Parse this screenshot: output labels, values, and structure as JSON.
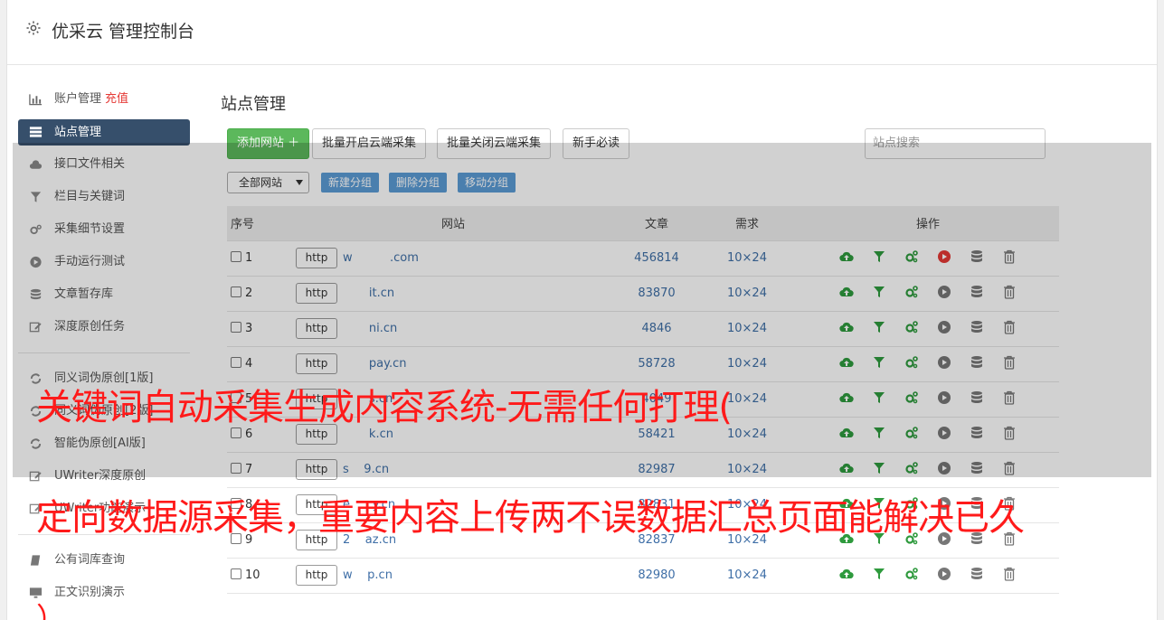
{
  "header": {
    "title": "优采云 管理控制台"
  },
  "sidebar": {
    "items": [
      {
        "label": "账户管理",
        "badge": "充值",
        "icon": "bar-chart-icon"
      },
      {
        "label": "站点管理",
        "icon": "server-icon",
        "active": true
      },
      {
        "label": "接口文件相关",
        "icon": "cloud-upload-icon"
      },
      {
        "label": "栏目与关键词",
        "icon": "filter-icon"
      },
      {
        "label": "采集细节设置",
        "icon": "cogs-icon"
      },
      {
        "label": "手动运行测试",
        "icon": "play-circle-icon"
      },
      {
        "label": "文章暂存库",
        "icon": "database-icon"
      },
      {
        "label": "深度原创任务",
        "icon": "edit-icon"
      }
    ],
    "items2": [
      {
        "label": "同义词伪原创[1版]",
        "icon": "refresh-icon"
      },
      {
        "label": "同义词伪原创[2版]",
        "icon": "refresh-icon"
      },
      {
        "label": "智能伪原创[AI版]",
        "icon": "refresh-icon"
      },
      {
        "label": "UWriter深度原创",
        "icon": "edit-icon"
      },
      {
        "label": "UWriter功能演示",
        "icon": "edit-icon"
      }
    ],
    "items3": [
      {
        "label": "公有词库查询",
        "icon": "book-icon"
      },
      {
        "label": "正文识别演示",
        "icon": "monitor-icon"
      }
    ]
  },
  "main": {
    "title": "站点管理",
    "toolbar": {
      "add": "添加网站 ＋",
      "batch_open": "批量开启云端采集",
      "batch_close": "批量关闭云端采集",
      "guide": "新手必读",
      "search_placeholder": "站点搜索"
    },
    "filter": {
      "group_select": "全部网站",
      "new_group": "新建分组",
      "delete_group": "删除分组",
      "move_group": "移动分组"
    },
    "table": {
      "headers": [
        "序号",
        "网站",
        "文章",
        "需求",
        "操作"
      ],
      "rows": [
        {
          "no": "1",
          "scheme": "http",
          "domain": "w          .com",
          "articles": "456814",
          "need": "10×24",
          "state": "running"
        },
        {
          "no": "2",
          "scheme": "http",
          "domain": "       it.cn",
          "articles": "83870",
          "need": "10×24",
          "state": "idle"
        },
        {
          "no": "3",
          "scheme": "http",
          "domain": "       ni.cn",
          "articles": "4846",
          "need": "10×24",
          "state": "idle"
        },
        {
          "no": "4",
          "scheme": "http",
          "domain": "       pay.cn",
          "articles": "58728",
          "need": "10×24",
          "state": "idle"
        },
        {
          "no": "5",
          "scheme": "http",
          "domain": "       s.cn",
          "articles": "4049",
          "need": "10×24",
          "state": "idle"
        },
        {
          "no": "6",
          "scheme": "http",
          "domain": "       k.cn",
          "articles": "58421",
          "need": "10×24",
          "state": "idle"
        },
        {
          "no": "7",
          "scheme": "http",
          "domain": "s    9.cn",
          "articles": "82987",
          "need": "10×24",
          "state": "idle"
        },
        {
          "no": "8",
          "scheme": "http",
          "domain": "e      y.cn",
          "articles": "82831",
          "need": "10×24",
          "state": "idle"
        },
        {
          "no": "9",
          "scheme": "http",
          "domain": "2    az.cn",
          "articles": "82837",
          "need": "10×24",
          "state": "idle"
        },
        {
          "no": "10",
          "scheme": "http",
          "domain": "w    p.cn",
          "articles": "82980",
          "need": "10×24",
          "state": "idle"
        }
      ]
    }
  },
  "caption": {
    "line1": "关键词自动采集生成内容系统-无需任何打理(",
    "line2": "定向数据源采集，重要内容上传两不误数据汇总页面能解决已久",
    "line3": "）"
  },
  "colors": {
    "sidebar_active": "#364f6b",
    "primary_green": "#5cb85c",
    "link_blue": "#3f6fa7",
    "caption_red": "#ff1a1a"
  }
}
